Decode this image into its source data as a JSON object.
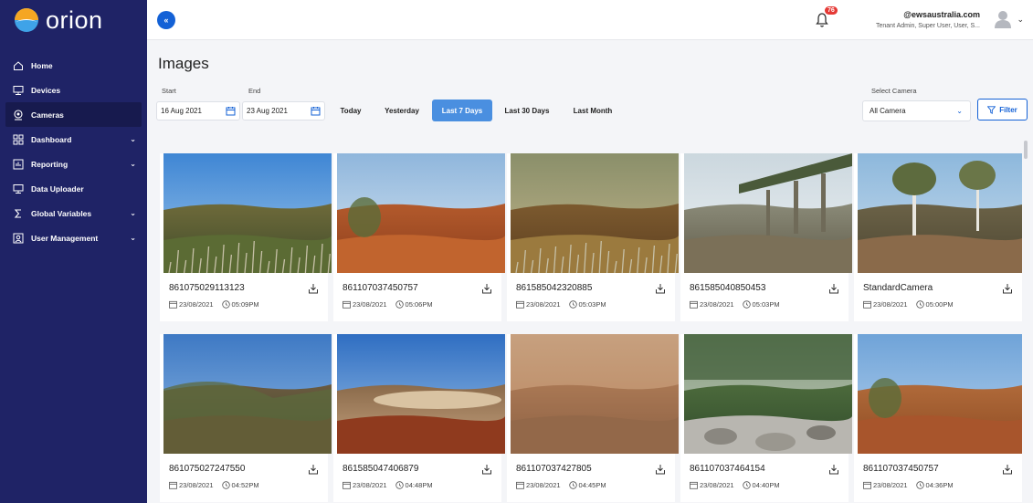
{
  "app": {
    "logo_text": "orion"
  },
  "sidebar": {
    "items": [
      {
        "label": "Home",
        "icon": "home-icon",
        "active": false,
        "expandable": false
      },
      {
        "label": "Devices",
        "icon": "monitor-icon",
        "active": false,
        "expandable": false
      },
      {
        "label": "Cameras",
        "icon": "camera-icon",
        "active": true,
        "expandable": false
      },
      {
        "label": "Dashboard",
        "icon": "dashboard-icon",
        "active": false,
        "expandable": true
      },
      {
        "label": "Reporting",
        "icon": "reporting-icon",
        "active": false,
        "expandable": true
      },
      {
        "label": "Data Uploader",
        "icon": "upload-icon",
        "active": false,
        "expandable": false
      },
      {
        "label": "Global Variables",
        "icon": "sigma-icon",
        "active": false,
        "expandable": true
      },
      {
        "label": "User Management",
        "icon": "user-icon",
        "active": false,
        "expandable": true
      }
    ]
  },
  "header": {
    "collapse_label": "«",
    "notification_count": "76",
    "user_email": "@ewsaustralia.com",
    "user_role": "Tenant Admin, Super User, User, S..."
  },
  "page": {
    "title": "Images",
    "start_label": "Start",
    "end_label": "End",
    "start_date": "16 Aug 2021",
    "end_date": "23 Aug 2021",
    "quick_filters": [
      "Today",
      "Yesterday",
      "Last 7 Days",
      "Last 30 Days",
      "Last Month"
    ],
    "active_quick_filter": "Last 7 Days",
    "camera_select_label": "Select Camera",
    "camera_select_value": "All Camera",
    "filter_button": "Filter"
  },
  "images": [
    {
      "camera": "861075029113123",
      "date": "23/08/2021",
      "time": "05:09PM"
    },
    {
      "camera": "861107037450757",
      "date": "23/08/2021",
      "time": "05:06PM"
    },
    {
      "camera": "861585042320885",
      "date": "23/08/2021",
      "time": "05:03PM"
    },
    {
      "camera": "861585040850453",
      "date": "23/08/2021",
      "time": "05:03PM"
    },
    {
      "camera": "StandardCamera",
      "date": "23/08/2021",
      "time": "05:00PM"
    },
    {
      "camera": "861075027247550",
      "date": "23/08/2021",
      "time": "04:52PM"
    },
    {
      "camera": "861585047406879",
      "date": "23/08/2021",
      "time": "04:48PM"
    },
    {
      "camera": "861107037427805",
      "date": "23/08/2021",
      "time": "04:45PM"
    },
    {
      "camera": "861107037464154",
      "date": "23/08/2021",
      "time": "04:40PM"
    },
    {
      "camera": "861107037450757",
      "date": "23/08/2021",
      "time": "04:36PM"
    }
  ],
  "colors": {
    "sidebar": "#1f2366",
    "accent": "#1361d6",
    "active_chip": "#4a8fe0",
    "badge": "#e53935"
  }
}
